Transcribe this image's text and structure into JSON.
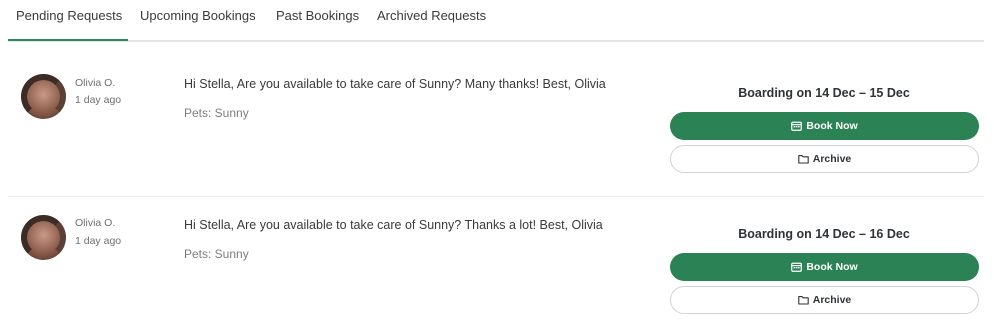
{
  "tabs": [
    {
      "label": "Pending Requests",
      "active": true
    },
    {
      "label": "Upcoming Bookings",
      "active": false
    },
    {
      "label": "Past Bookings",
      "active": false
    },
    {
      "label": "Archived Requests",
      "active": false
    }
  ],
  "colors": {
    "accent": "#2b8254",
    "tab_underline": "#2b8a5a",
    "divider": "#e3e5e6"
  },
  "requests": [
    {
      "owner_name": "Olivia O.",
      "time_ago": "1 day ago",
      "message": "Hi Stella, Are you available to take care of Sunny? Many thanks! Best, Olivia",
      "pets": "Pets: Sunny",
      "booking": "Boarding on 14 Dec – 15 Dec",
      "book_label": "Book Now",
      "book_icon": "calendar-icon",
      "archive_label": "Archive",
      "archive_icon": "folder-icon"
    },
    {
      "owner_name": "Olivia O.",
      "time_ago": "1 day ago",
      "message": "Hi Stella, Are you available to take care of Sunny? Thanks a lot! Best, Olivia",
      "pets": "Pets: Sunny",
      "booking": "Boarding on 14 Dec – 16 Dec",
      "book_label": "Book Now",
      "book_icon": "calendar-icon",
      "archive_label": "Archive",
      "archive_icon": "folder-icon"
    }
  ]
}
